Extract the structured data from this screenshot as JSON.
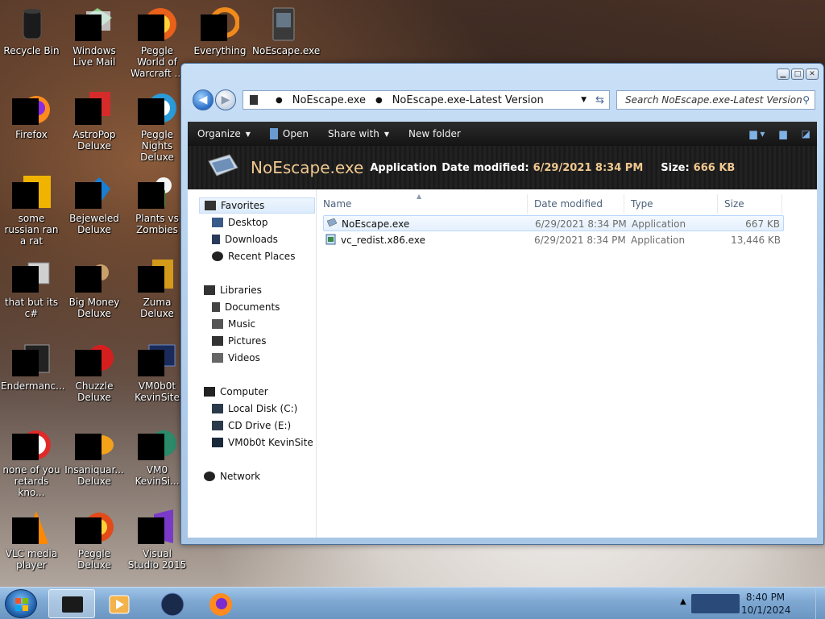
{
  "desktop": {
    "icons": [
      {
        "label": "Recycle Bin",
        "icon": "recycle-bin-icon"
      },
      {
        "label": "Windows Live Mail",
        "icon": "mail-icon"
      },
      {
        "label": "Peggle World of Warcraft ...",
        "icon": "peggle-icon"
      },
      {
        "label": "Everything",
        "icon": "everything-icon"
      },
      {
        "label": "NoEscape.exe",
        "icon": "exe-icon"
      },
      {
        "label": "Firefox",
        "icon": "firefox-icon"
      },
      {
        "label": "AstroPop Deluxe",
        "icon": "game-icon"
      },
      {
        "label": "Peggle Nights Deluxe",
        "icon": "peggle-icon"
      },
      {
        "label": "some russian ran a rat",
        "icon": "file-icon"
      },
      {
        "label": "Bejeweled Deluxe",
        "icon": "game-icon"
      },
      {
        "label": "Plants vs Zombies",
        "icon": "game-icon"
      },
      {
        "label": "that but its c#",
        "icon": "file-icon"
      },
      {
        "label": "Big Money Deluxe",
        "icon": "game-icon"
      },
      {
        "label": "Zuma Deluxe",
        "icon": "game-icon"
      },
      {
        "label": "Endermanc...",
        "icon": "file-icon"
      },
      {
        "label": "Chuzzle Deluxe",
        "icon": "game-icon"
      },
      {
        "label": "VM0b0t KevinSite",
        "icon": "monitor-icon"
      },
      {
        "label": "none of you retards kno...",
        "icon": "file-icon"
      },
      {
        "label": "Insaniquar... Deluxe",
        "icon": "game-icon"
      },
      {
        "label": "VM0 KevinSi...",
        "icon": "monitor-icon"
      },
      {
        "label": "VLC media player",
        "icon": "vlc-icon"
      },
      {
        "label": "Peggle Deluxe",
        "icon": "peggle-icon"
      },
      {
        "label": "Visual Studio 2015",
        "icon": "visual-studio-icon"
      }
    ]
  },
  "window": {
    "address": {
      "crumb1": "NoEscape.exe",
      "crumb2": "NoEscape.exe-Latest Version"
    },
    "search_placeholder": "Search NoEscape.exe-Latest Version",
    "toolbar": {
      "organize": "Organize",
      "open": "Open",
      "share_with": "Share with",
      "new_folder": "New folder"
    },
    "details": {
      "name": "NoEscape.exe",
      "type": "Application",
      "date_label": "Date modified:",
      "date_value": "6/29/2021 8:34 PM",
      "size_label": "Size:",
      "size_value": "666 KB"
    },
    "nav": {
      "favorites": "Favorites",
      "desktop": "Desktop",
      "downloads": "Downloads",
      "recent": "Recent Places",
      "libraries": "Libraries",
      "documents": "Documents",
      "music": "Music",
      "pictures": "Pictures",
      "videos": "Videos",
      "computer": "Computer",
      "local_disk": "Local Disk (C:)",
      "cd_drive": "CD Drive (E:)",
      "vm_site": "VM0b0t KevinSite",
      "network": "Network"
    },
    "columns": {
      "name": "Name",
      "date": "Date modified",
      "type": "Type",
      "size": "Size"
    },
    "files": [
      {
        "name": "NoEscape.exe",
        "date": "6/29/2021 8:34 PM",
        "type": "Application",
        "size": "667 KB"
      },
      {
        "name": "vc_redist.x86.exe",
        "date": "6/29/2021 8:34 PM",
        "type": "Application",
        "size": "13,446 KB"
      }
    ]
  },
  "taskbar": {
    "time": "8:40 PM",
    "date": "10/1/2024"
  }
}
